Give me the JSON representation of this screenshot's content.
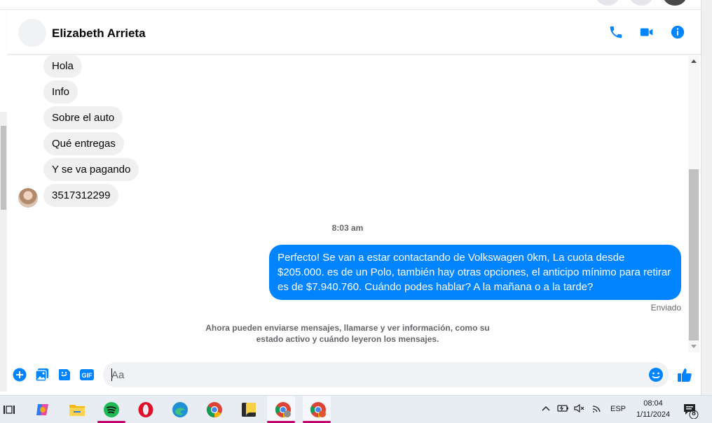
{
  "header": {
    "contact_name": "Elizabeth Arrieta",
    "icons": [
      "phone-icon",
      "video-camera-icon",
      "info-icon"
    ]
  },
  "messages": {
    "incoming": [
      "Hola",
      "Info",
      "Sobre el auto",
      "Qué entregas",
      "Y se va pagando",
      "3517312299"
    ],
    "timestamp": "8:03 am",
    "outgoing": "Perfecto!  Se van a estar contactando de Volkswagen 0km, La cuota desde $205.000. es de un Polo, también hay otras opciones, el anticipo mínimo para retirar es de $7.940.760. Cuándo podes hablar? A la mañana o a la tarde?",
    "status": "Enviado",
    "notice": "Ahora pueden enviarse mensajes, llamarse y ver información, como su estado activo y cuándo leyeron los mensajes."
  },
  "composer": {
    "placeholder": "Aa",
    "gif_label": "GIF",
    "icons": [
      "plus-icon",
      "image-icon",
      "sticker-icon",
      "gif-icon",
      "emoji-icon",
      "thumbs-up-icon"
    ]
  },
  "taskbar": {
    "language": "ESP",
    "time": "08:04",
    "date": "1/11/2024",
    "notification_count": "8",
    "apps": [
      "task-view",
      "copilot",
      "file-explorer",
      "spotify",
      "opera",
      "edge",
      "chrome",
      "sticky-notes",
      "chrome-profile-1",
      "chrome-profile-2"
    ]
  },
  "colors": {
    "accent": "#0084ff",
    "incoming_bubble": "#f0f0f0",
    "secondary_text": "#65676b",
    "taskbar": "#e8edf3"
  }
}
